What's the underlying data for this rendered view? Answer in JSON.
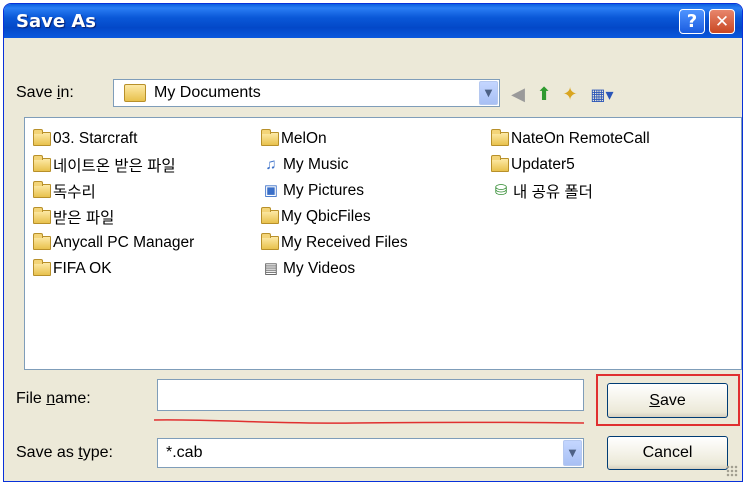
{
  "window": {
    "title": "Save As"
  },
  "titlebar": {
    "help_glyph": "?",
    "close_glyph": "✕"
  },
  "save_in": {
    "label_pre": "Save ",
    "label_u": "i",
    "label_post": "n:",
    "value": "My Documents"
  },
  "toolbar": {
    "icons": [
      "back-icon",
      "up-folder-icon",
      "new-folder-icon",
      "view-menu-icon"
    ]
  },
  "files": {
    "column1": [
      "03. Starcraft",
      "네이트온 받은 파일",
      "독수리",
      "받은 파일",
      "Anycall PC Manager",
      "FIFA OK"
    ],
    "column2": [
      "MelOn",
      "My Music",
      "My Pictures",
      "My QbicFiles",
      "My Received Files",
      "My Videos"
    ],
    "column3": [
      "NateOn RemoteCall",
      "Updater5",
      "내 공유 폴더"
    ]
  },
  "file_name": {
    "label_pre": "File ",
    "label_u": "n",
    "label_post": "ame:",
    "value": ""
  },
  "save_as_type": {
    "label_pre": "Save as ",
    "label_u": "t",
    "label_post": "ype:",
    "value": "*.cab"
  },
  "buttons": {
    "save_u": "S",
    "save_rest": "ave",
    "cancel": "Cancel"
  },
  "colors": {
    "title_bar": "#0a58d8",
    "dialog_bg": "#ece9d8",
    "annotation": "#e03030"
  }
}
